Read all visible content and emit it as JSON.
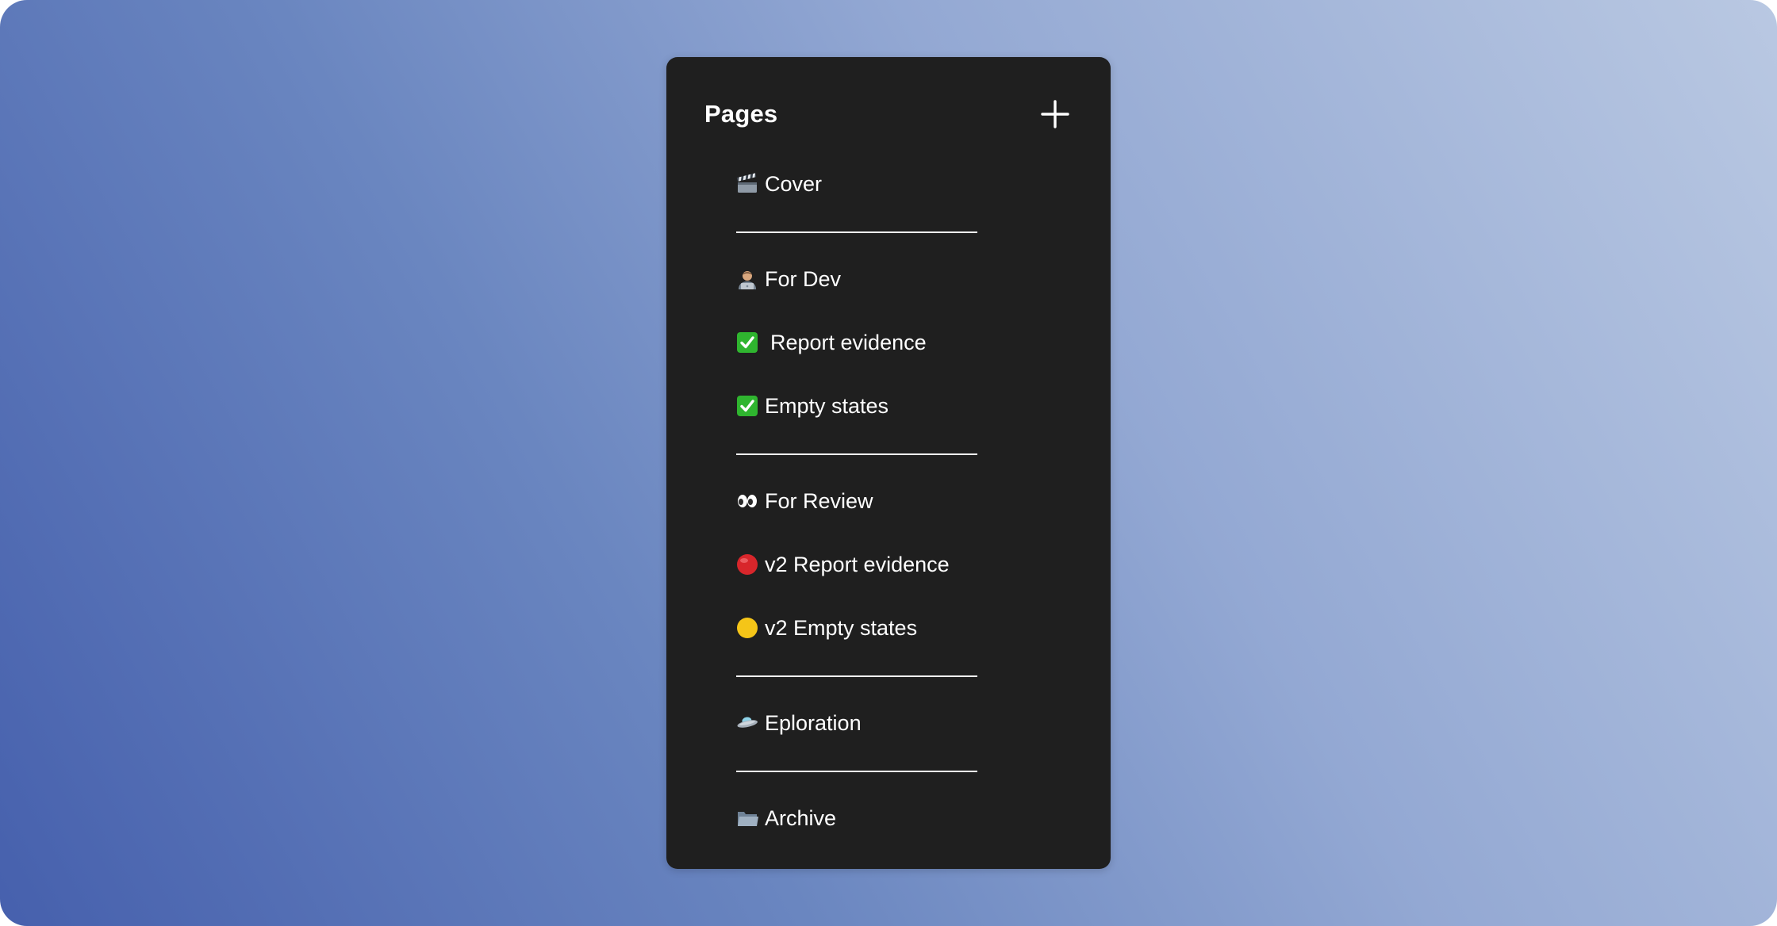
{
  "panel": {
    "title": "Pages",
    "add_icon": "plus-icon"
  },
  "pages": [
    {
      "label": "Cover",
      "icon": "clapperboard-icon"
    },
    {
      "label": "For Dev",
      "icon": "technologist-icon"
    },
    {
      "label": "Report evidence",
      "icon": "check-mark-button-icon"
    },
    {
      "label": "Empty states",
      "icon": "check-mark-button-icon"
    },
    {
      "label": "For Review",
      "icon": "eyes-icon"
    },
    {
      "label": "v2 Report evidence",
      "icon": "red-circle-icon"
    },
    {
      "label": "v2 Empty states",
      "icon": "yellow-circle-icon"
    },
    {
      "label": "Eploration",
      "icon": "flying-saucer-icon"
    },
    {
      "label": "Archive",
      "icon": "folder-icon"
    }
  ],
  "colors": {
    "panel_bg": "#1f1f1f",
    "text": "#ffffff",
    "check_green": "#2fb52f",
    "red_circle": "#d8262b",
    "yellow_circle": "#f5c518"
  }
}
